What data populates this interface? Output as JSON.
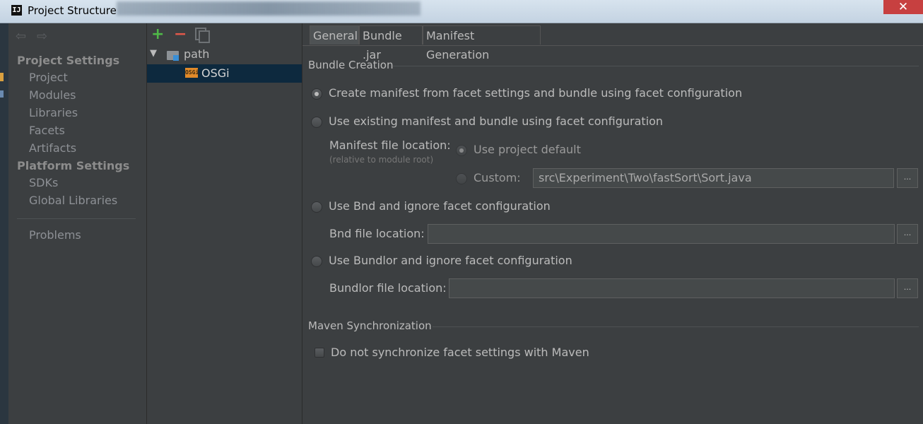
{
  "window": {
    "title": "Project Structure",
    "logo_text": "IJ",
    "close_glyph": "✕"
  },
  "sidebar": {
    "nav_back_icon": "arrow-left-icon",
    "nav_forward_icon": "arrow-right-icon",
    "project_settings_header": "Project Settings",
    "project_settings_items": [
      "Project",
      "Modules",
      "Libraries",
      "Facets",
      "Artifacts"
    ],
    "platform_settings_header": "Platform Settings",
    "platform_settings_items": [
      "SDKs",
      "Global Libraries"
    ],
    "problems": "Problems"
  },
  "tree": {
    "toolbar": {
      "add": "+",
      "remove": "−",
      "copy_icon": "copy-icon"
    },
    "root": {
      "label": "path",
      "expanded": true,
      "icon": "module-folder-icon"
    },
    "child": {
      "label": "OSGi",
      "icon_text": "OSGi",
      "selected": true
    }
  },
  "main": {
    "tabs": [
      {
        "label": "General",
        "selected": true
      },
      {
        "label": "Bundle .jar",
        "selected": false
      },
      {
        "label": "Manifest Generation",
        "selected": false
      }
    ],
    "bundle_creation": {
      "title": "Bundle Creation",
      "option_facet": "Create manifest from facet settings and bundle using facet configuration",
      "option_existing": "Use existing manifest and bundle using facet configuration",
      "manifest_location_label": "Manifest file location:",
      "manifest_location_hint": "(relative to module root)",
      "use_project_default": "Use project default",
      "custom_label": "Custom:",
      "custom_value": "src\\Experiment\\Two\\fastSort\\Sort.java",
      "option_bnd": "Use Bnd and ignore facet configuration",
      "bnd_location_label": "Bnd file location:",
      "bnd_location_value": "",
      "option_bundlor": "Use Bundlor and ignore facet configuration",
      "bundlor_location_label": "Bundlor file location:",
      "bundlor_location_value": "",
      "browse_label": "..."
    },
    "maven_sync": {
      "title": "Maven Synchronization",
      "checkbox_label": "Do not synchronize facet settings with Maven",
      "checked": false
    }
  },
  "colors": {
    "background": "#3c3f41",
    "selection": "#0d293e",
    "add_green": "#4fb848",
    "remove_red": "#e0584a",
    "osgi_orange": "#e08a2a"
  }
}
